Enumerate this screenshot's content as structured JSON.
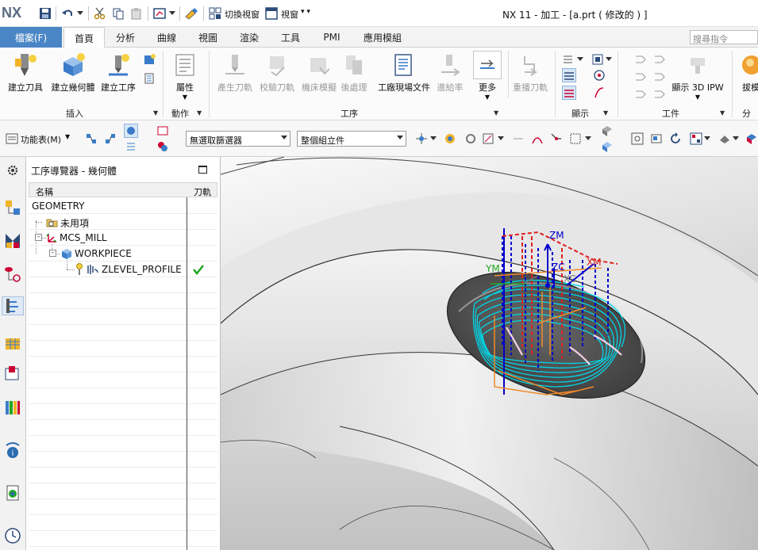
{
  "app": {
    "logo": "NX",
    "window_title": "NX 11 - 加工 - [a.prt  ( 修改的 ) ]",
    "quick_access": {
      "switch_window": "切換視窗",
      "window": "視窗"
    }
  },
  "menu": {
    "file": "檔案(F)",
    "tabs": [
      "首頁",
      "分析",
      "曲線",
      "視圖",
      "渲染",
      "工具",
      "PMI",
      "應用模組"
    ],
    "active_tab": "首頁",
    "search_placeholder": "搜尋指令"
  },
  "ribbon": {
    "insert": {
      "label": "插入",
      "create_tool": "建立刀具",
      "create_geometry": "建立幾何體",
      "create_operation": "建立工序"
    },
    "actions": {
      "label": "動作",
      "properties": "屬性"
    },
    "operations": {
      "label": "工序",
      "generate_toolpath": "產生刀軌",
      "verify_toolpath": "校驗刀軌",
      "machine_simulation": "機床模擬",
      "postprocess": "後處理",
      "shop_docs": "工廠現場文件",
      "feed_rate": "進給率",
      "more": "更多",
      "replay_toolpath": "重播刀軌"
    },
    "display": {
      "label": "顯示"
    },
    "workpiece": {
      "label": "工件",
      "show_3d_ipw": "顯示 3D IPW"
    },
    "extract": {
      "label": "拔模"
    },
    "analysis": {
      "label": "分析"
    }
  },
  "toolbar2": {
    "function_menu": "功能表(M)",
    "filter_select": "無選取篩選器",
    "assembly_select": "整個組立件"
  },
  "navigator": {
    "title": "工序導覽器 - 幾何體",
    "columns": {
      "name": "名稱",
      "path": "刀軌"
    },
    "rows": [
      {
        "name": "GEOMETRY",
        "icon": "none",
        "status": ""
      },
      {
        "name": "未用項",
        "icon": "unused-folder-icon",
        "status": ""
      },
      {
        "name": "MCS_MILL",
        "icon": "mcs-icon",
        "status": ""
      },
      {
        "name": "WORKPIECE",
        "icon": "workpiece-icon",
        "status": ""
      },
      {
        "name": "ZLEVEL_PROFILE",
        "icon": "zlevel-operation-icon",
        "status": "complete"
      }
    ]
  },
  "viewport": {
    "labels": {
      "zm": "ZM",
      "zc": "ZC",
      "xm": "XM",
      "xc": "XC",
      "ym": "YM"
    }
  },
  "colors": {
    "file_tab": "#4a86c5",
    "toolpath_cyan": "#00d7e8",
    "toolpath_blue": "#0000cc",
    "toolpath_red": "#e0201e",
    "toolpath_orange": "#f08a2b",
    "check_green": "#22a722"
  }
}
